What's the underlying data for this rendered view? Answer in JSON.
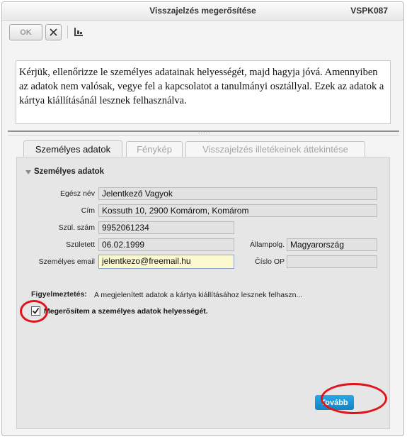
{
  "window": {
    "title": "Visszajelzés megerősítése",
    "code": "VSPK087"
  },
  "toolbar": {
    "ok_label": "OK"
  },
  "info_text": "Kérjük, ellenőrizze le személyes adatainak helyességét, majd hagyja jóvá. Amennyiben az adatok nem valósak, vegye fel a kapcsolatot a tanulmányi osztállyal. Ezek az adatok a kártya kiállításánál lesznek felhasználva.",
  "splitter_dots": ".....",
  "tabs": [
    {
      "label": "Személyes adatok",
      "active": true
    },
    {
      "label": "Fénykép",
      "active": false
    },
    {
      "label": "Visszajelzés illetékeinek áttekintése",
      "active": false
    }
  ],
  "section": {
    "title": "Személyes adatok"
  },
  "fields": {
    "full_name": {
      "label": "Egész név",
      "value": "Jelentkező Vagyok"
    },
    "address": {
      "label": "Cím",
      "value": "Kossuth 10, 2900  Komárom, Komárom"
    },
    "birth_number": {
      "label": "Szül. szám",
      "value": "9952061234"
    },
    "birth_date": {
      "label": "Született",
      "value": "06.02.1999"
    },
    "citizenship": {
      "label": "Állampolg.",
      "value": "Magyarország"
    },
    "email": {
      "label": "Személyes email",
      "value": "jelentkezo@freemail.hu"
    },
    "op_number": {
      "label": "Číslo OP",
      "value": ""
    }
  },
  "warning": {
    "label": "Figyelmeztetés:",
    "text": "A megjelenített adatok a kártya kiállításához lesznek felhaszn..."
  },
  "confirm": {
    "label": "Megerősítem a személyes adatok helyességét.",
    "checked": true
  },
  "next_button": {
    "label": "Tovább"
  },
  "colors": {
    "accent_button": "#1a95d6",
    "highlight_circle": "#e0141b",
    "active_field_bg": "#fcf8d0"
  }
}
